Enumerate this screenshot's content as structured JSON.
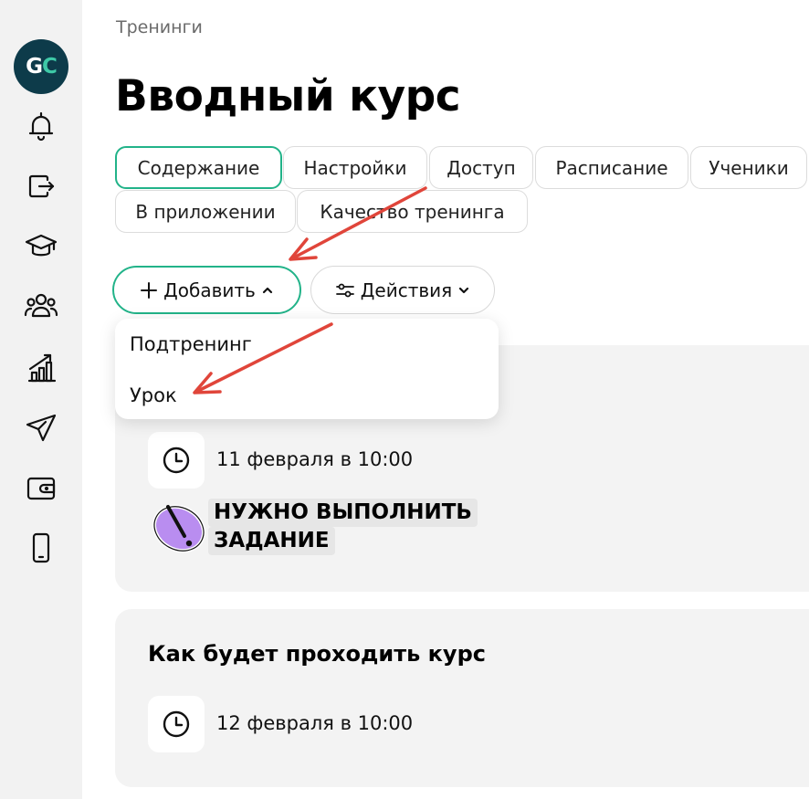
{
  "logo": {
    "letter1": "G",
    "letter2": "C"
  },
  "sidebar": {
    "items": [
      {
        "name": "bell-icon"
      },
      {
        "name": "sign-out-icon"
      },
      {
        "name": "graduation-cap-icon"
      },
      {
        "name": "users-icon"
      },
      {
        "name": "chart-growth-icon"
      },
      {
        "name": "paper-plane-icon"
      },
      {
        "name": "wallet-icon"
      },
      {
        "name": "mobile-phone-icon"
      }
    ]
  },
  "breadcrumb": "Тренинги",
  "page_title": "Вводный курс",
  "tabs": [
    {
      "label": "Содержание",
      "active": true
    },
    {
      "label": "Настройки"
    },
    {
      "label": "Доступ"
    },
    {
      "label": "Расписание"
    },
    {
      "label": "Ученики"
    },
    {
      "label": "В приложении"
    },
    {
      "label": "Качество тренинга"
    }
  ],
  "toolbar": {
    "add_label": "Добавить",
    "actions_label": "Действия"
  },
  "dropdown": {
    "items": [
      {
        "label": "Подтренинг"
      },
      {
        "label": "Урок"
      }
    ]
  },
  "card1": {
    "date": "11 февраля в 10:00",
    "task_line1": "НУЖНО ВЫПОЛНИТЬ",
    "task_line2": "ЗАДАНИЕ"
  },
  "card2": {
    "title": "Как будет проходить курс",
    "date": "12 февраля в 10:00"
  },
  "colors": {
    "accent": "#22b389",
    "arrow": "#e0453a",
    "logo_bg": "#0d3b4a",
    "task_icon": "#b98df0"
  }
}
